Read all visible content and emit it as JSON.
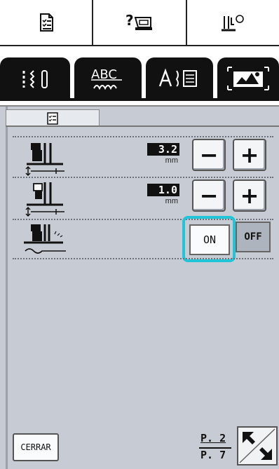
{
  "icons": {
    "top": [
      "settings-sheet-icon",
      "help-machine-icon",
      "needle-mode-icon"
    ],
    "tabs": [
      "utility-stitch-icon",
      "character-stitch-icon",
      "decorative-stitch-icon",
      "embroidery-icon"
    ]
  },
  "settings": {
    "rows": [
      {
        "value": "3.2",
        "unit": "mm",
        "minus": "−",
        "plus": "+"
      },
      {
        "value": "1.0",
        "unit": "mm",
        "minus": "−",
        "plus": "+"
      }
    ],
    "toggle": {
      "on": "ON",
      "off": "OFF",
      "selected": "ON"
    }
  },
  "footer": {
    "close_label": "CERRAR",
    "page_current": "P. 2",
    "page_total": "P. 7"
  },
  "colors": {
    "highlight": "#22c5d8",
    "panel": "#c7ccd4"
  }
}
